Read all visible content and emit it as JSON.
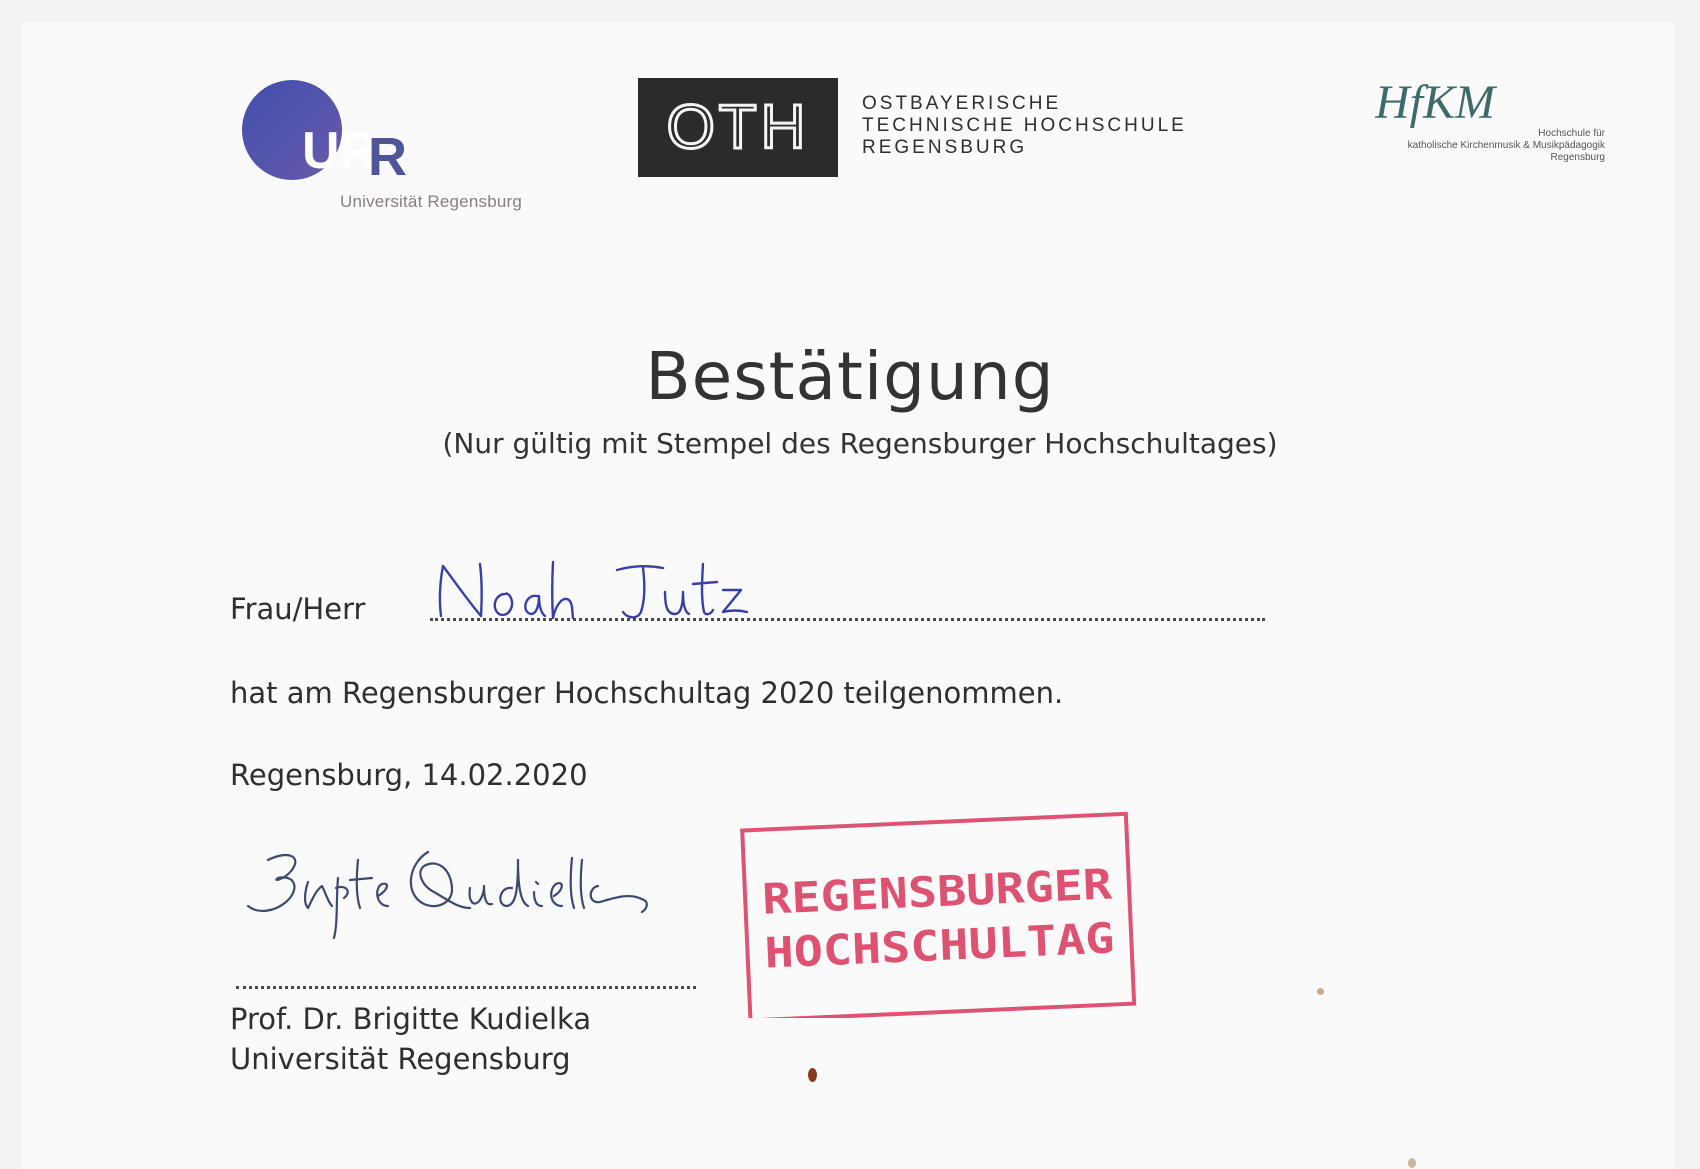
{
  "logos": {
    "ur_initials": "UR",
    "ur_caption": "Universität Regensburg",
    "oth_mark": "OTH",
    "oth_lines": [
      "OSTBAYERISCHE",
      "TECHNISCHE HOCHSCHULE",
      "REGENSBURG"
    ],
    "hfkm_mark": "HfKM",
    "hfkm_lines": [
      "Hochschule für",
      "katholische Kirchenmusik & Musikpädagogik",
      "Regensburg"
    ]
  },
  "document": {
    "title": "Bestätigung",
    "subtitle": "(Nur gültig mit Stempel des Regensburger Hochschultages)",
    "name_label": "Frau/Herr",
    "name_handwritten": "Noah Jutz",
    "participation": "hat am Regensburger Hochschultag 2020 teilgenommen.",
    "place_date": "Regensburg, 14.02.2020",
    "signature_handwritten": "Brigitte Kudielka",
    "signer_name": "Prof. Dr. Brigitte Kudielka",
    "signer_institution": "Universität Regensburg"
  },
  "stamp": {
    "line1": "REGENSBURGER",
    "line2": "HOCHSCHULTAG",
    "color": "#d8345a"
  },
  "colors": {
    "ur_blue": "#4a55b0",
    "ink_blue": "#3a3fa6",
    "paper": "#fbfafb"
  }
}
